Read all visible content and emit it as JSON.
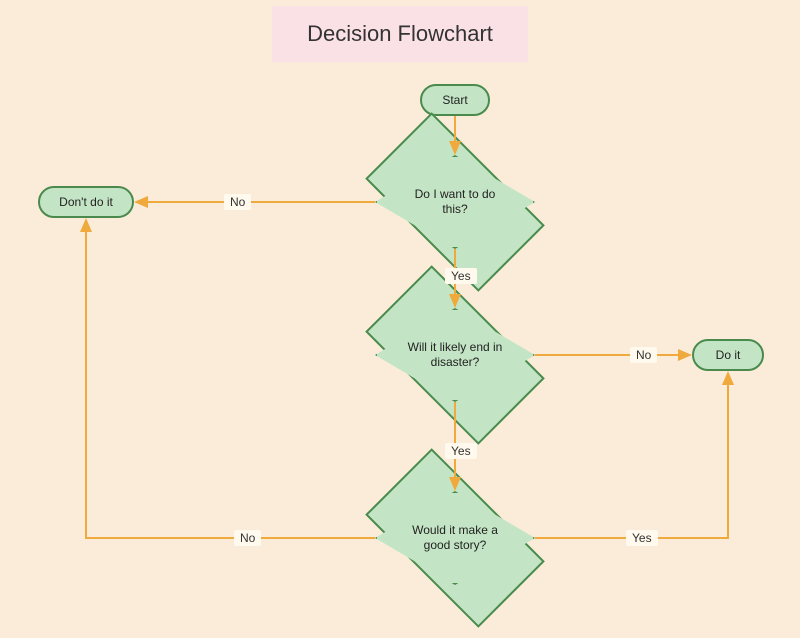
{
  "title": "Decision Flowchart",
  "nodes": {
    "start": {
      "label": "Start",
      "type": "terminator"
    },
    "dont": {
      "label": "Don't do it",
      "type": "terminator"
    },
    "doit": {
      "label": "Do it",
      "type": "terminator"
    },
    "want": {
      "label": "Do I want to do this?",
      "type": "decision"
    },
    "disaster": {
      "label": "Will it likely end in disaster?",
      "type": "decision"
    },
    "story": {
      "label": "Would it make a good story?",
      "type": "decision"
    }
  },
  "edges": {
    "start_want": {
      "from": "start",
      "to": "want",
      "label": ""
    },
    "want_no": {
      "from": "want",
      "to": "dont",
      "label": "No"
    },
    "want_yes": {
      "from": "want",
      "to": "disaster",
      "label": "Yes"
    },
    "disaster_no": {
      "from": "disaster",
      "to": "doit",
      "label": "No"
    },
    "disaster_yes": {
      "from": "disaster",
      "to": "story",
      "label": "Yes"
    },
    "story_no": {
      "from": "story",
      "to": "dont",
      "label": "No"
    },
    "story_yes": {
      "from": "story",
      "to": "doit",
      "label": "Yes"
    }
  },
  "colors": {
    "background": "#fbecd9",
    "title_bg": "#fae1e6",
    "node_fill": "#c4e5c5",
    "node_stroke": "#4a8a4d",
    "connector": "#f0a93c"
  }
}
